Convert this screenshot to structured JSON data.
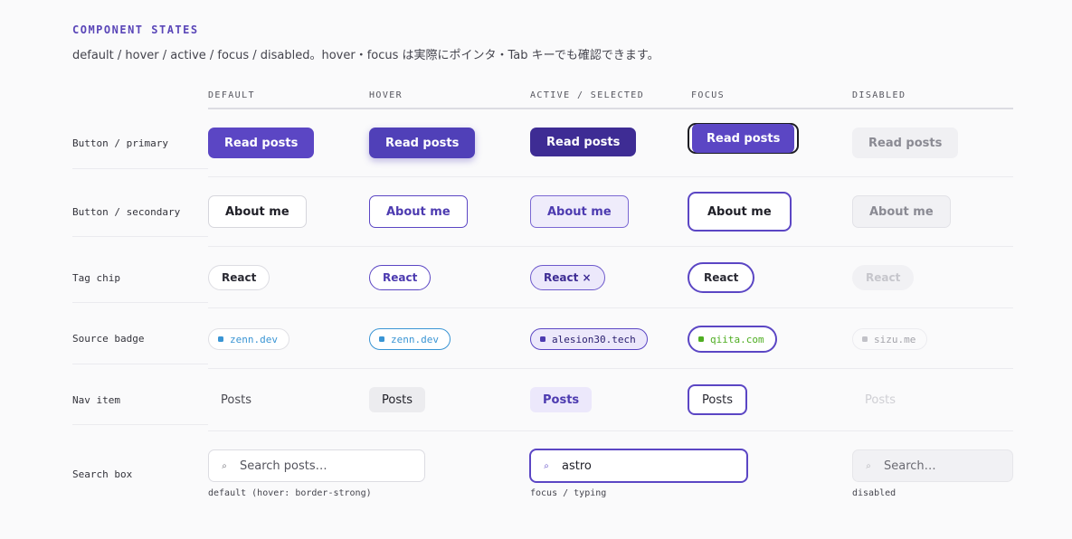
{
  "header": {
    "title": "COMPONENT STATES",
    "subtitle": "default / hover / active / focus / disabled。hover・focus は実際にポインタ・Tab キーでも確認できます。"
  },
  "columns": [
    "DEFAULT",
    "HOVER",
    "ACTIVE / SELECTED",
    "FOCUS",
    "DISABLED"
  ],
  "rows": {
    "button_primary": {
      "label": "Button / primary",
      "default": "Read posts",
      "hover": "Read posts",
      "active": "Read posts",
      "focus": "Read posts",
      "disabled": "Read posts"
    },
    "button_secondary": {
      "label": "Button / secondary",
      "default": "About me",
      "hover": "About me",
      "active": "About me",
      "focus": "About me",
      "disabled": "About me"
    },
    "tag_chip": {
      "label": "Tag chip",
      "default": "React",
      "hover": "React",
      "active": "React ×",
      "focus": "React",
      "disabled": "React"
    },
    "source_badge": {
      "label": "Source badge",
      "default": "zenn.dev",
      "hover": "zenn.dev",
      "active": "alesion30.tech",
      "focus": "qiita.com",
      "disabled": "sizu.me"
    },
    "nav_item": {
      "label": "Nav item",
      "default": "Posts",
      "hover": "Posts",
      "active": "Posts",
      "focus": "Posts",
      "disabled": "Posts"
    },
    "search_box": {
      "label": "Search box",
      "default_placeholder": "Search posts…",
      "default_caption": "default (hover: border-strong)",
      "focus_value": "astro",
      "focus_caption": "focus / typing",
      "disabled_placeholder": "Search…",
      "disabled_caption": "disabled",
      "icon": "search-icon"
    }
  },
  "colors": {
    "accent": "#5b46c4",
    "accent_active": "#3e2c94",
    "zenn_blue": "#3a95d4",
    "qiita_green": "#4fae22"
  }
}
